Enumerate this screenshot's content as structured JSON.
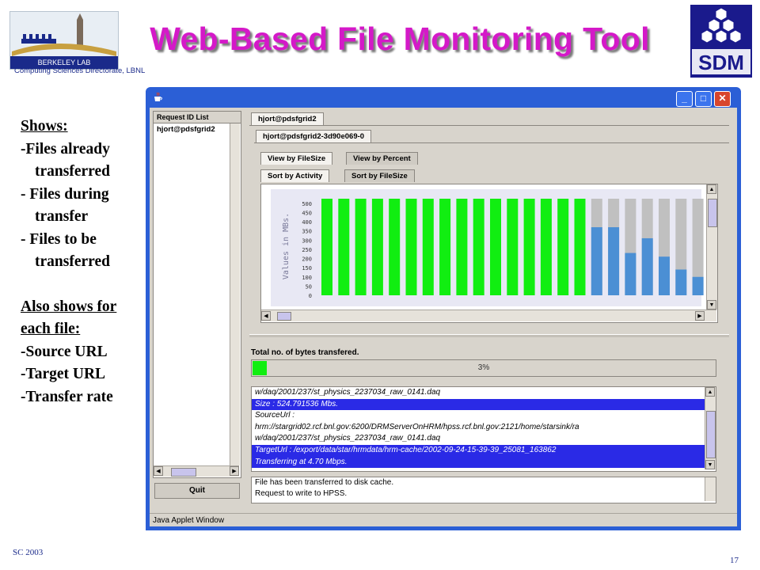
{
  "slide": {
    "title": "Web-Based File Monitoring Tool",
    "logo_caption": "Computing Sciences Directorate, LBNL",
    "logo_text": "BERKELEY LAB",
    "sdm_logo_text": "SDM",
    "footer_left": "SC 2003",
    "page_number": "17",
    "bullets": {
      "shows_heading": "Shows:",
      "items": [
        "-Files already",
        "transferred",
        "- Files during",
        "transfer",
        "- Files to be",
        "transferred"
      ],
      "also_heading_1": "Also shows for",
      "also_heading_2": "each file:",
      "details": [
        "-Source URL",
        "-Target URL",
        "-Transfer rate"
      ]
    },
    "title_color": "#d419c8"
  },
  "window": {
    "title_icon": "java-cup-icon",
    "status_bar": "Java Applet Window",
    "controls": [
      "minimize-icon",
      "maximize-icon",
      "close-icon"
    ]
  },
  "request_list": {
    "header": "Request ID List",
    "items": [
      "hjort@pdsfgrid2"
    ],
    "quit_label": "Quit"
  },
  "tabs": {
    "user_tab": "hjort@pdsfgrid2",
    "request_tab": "hjort@pdsfgrid2-3d90e069-0",
    "view_tabs": [
      "View by FileSize",
      "View by Percent"
    ],
    "sort_tabs": [
      "Sort by Activity",
      "Sort by FileSize"
    ]
  },
  "chart_data": {
    "type": "bar",
    "ylabel": "Values in MBs.",
    "yticks": [
      "500",
      "450",
      "400",
      "350",
      "300",
      "250",
      "200",
      "150",
      "100",
      "50",
      "0"
    ],
    "ylim": [
      0,
      525
    ],
    "series": [
      {
        "values": [
          525,
          525,
          525,
          525,
          525,
          525,
          525,
          525,
          525,
          525,
          525,
          525,
          525,
          525,
          525,
          525,
          0,
          0,
          0,
          0,
          0,
          0,
          0,
          0
        ],
        "color": "#11ee11"
      },
      {
        "values": [
          0,
          0,
          0,
          0,
          0,
          0,
          0,
          0,
          0,
          0,
          0,
          0,
          0,
          0,
          0,
          0,
          370,
          370,
          230,
          310,
          210,
          140,
          100,
          0
        ],
        "color": "#4b8fd4"
      },
      {
        "values": [
          0,
          0,
          0,
          0,
          0,
          0,
          0,
          0,
          0,
          0,
          0,
          0,
          0,
          0,
          0,
          0,
          525,
          525,
          525,
          525,
          525,
          525,
          525,
          525
        ],
        "color": "#c0c0c0"
      }
    ],
    "bar_count": 24
  },
  "transfer": {
    "label": "Total no. of bytes transfered.",
    "percent_text": "3%",
    "percent": 3,
    "fill_color": "#11ee11"
  },
  "log": {
    "lines": [
      {
        "text": "w/daq/2001/237/st_physics_2237034_raw_0141.daq",
        "hl": false
      },
      {
        "text": "  Size           : 524.791536 Mbs.",
        "hl": true
      },
      {
        "text": "  SourceUrl       :",
        "hl": false
      },
      {
        "text": "hrm://stargrid02.rcf.bnl.gov:6200/DRMServerOnHRM/hpss.rcf.bnl.gov:2121/home/starsink/ra",
        "hl": false
      },
      {
        "text": "w/daq/2001/237/st_physics_2237034_raw_0141.daq",
        "hl": false
      },
      {
        "text": "  TargetUrl      : /export/data/star/hrmdata/hrm-cache/2002-09-24-15-39-39_25081_163862",
        "hl": true
      },
      {
        "text": "  Transferring at 4.70 Mbps.",
        "hl": true
      }
    ]
  },
  "messages": {
    "lines": [
      "File has been transferred to disk cache.",
      "Request to write to HPSS."
    ]
  }
}
